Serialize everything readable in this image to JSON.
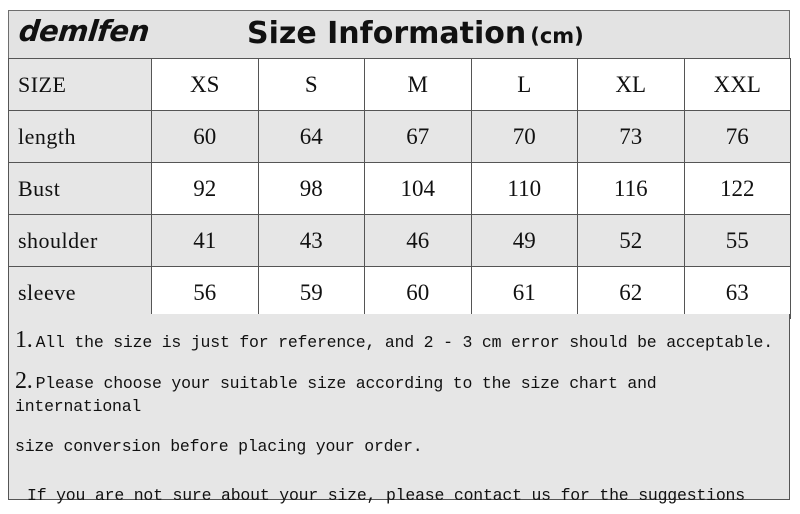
{
  "header": {
    "brand": "demlfen",
    "title": "Size Information",
    "unit": "(cm)"
  },
  "table": {
    "corner_label": "SIZE",
    "sizes": [
      "XS",
      "S",
      "M",
      "L",
      "XL",
      "XXL"
    ],
    "rows": [
      {
        "label": "length",
        "values": [
          "60",
          "64",
          "67",
          "70",
          "73",
          "76"
        ]
      },
      {
        "label": "Bust",
        "values": [
          "92",
          "98",
          "104",
          "110",
          "116",
          "122"
        ]
      },
      {
        "label": "shoulder",
        "values": [
          "41",
          "43",
          "46",
          "49",
          "52",
          "55"
        ]
      },
      {
        "label": "sleeve",
        "values": [
          "56",
          "59",
          "60",
          "61",
          "62",
          "63"
        ]
      }
    ]
  },
  "notes": {
    "note1_num": "1.",
    "note1_text": "All the size is just for reference, and 2 - 3 cm error should be acceptable.",
    "note2_num": "2.",
    "note2_text_line1": "Please choose your suitable size according to the size chart and international",
    "note2_text_line2": "size conversion before placing your order.",
    "note3_text": "If you are not sure about your size, please contact us for the suggestions"
  },
  "colors": {
    "shade": "#e6e6e6",
    "header_band": "#e3e3e3",
    "border": "#555555",
    "text": "#111111"
  }
}
